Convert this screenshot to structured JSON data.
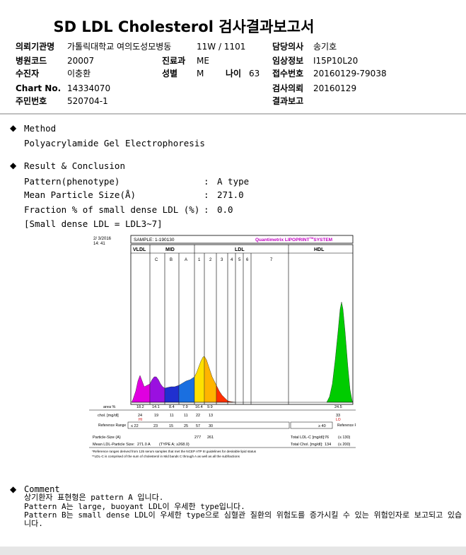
{
  "report": {
    "title": "SD LDL Cholesterol 검사결과보고서"
  },
  "info": {
    "institution_label": "의뢰기관명",
    "institution": "가톨릭대학교 여의도성모병동",
    "ward": "11W / 1101",
    "doctor_label": "담당의사",
    "doctor": "송기호",
    "hospital_code_label": "병원코드",
    "hospital_code": "20007",
    "department_label": "진료과",
    "department": "ME",
    "clinical_label": "임상정보",
    "clinical": "I15P10L20",
    "patient_label": "수진자",
    "patient": "이충환",
    "sex_label": "성별",
    "sex": "M",
    "age_label": "나이",
    "age": "63",
    "receipt_label": "접수번호",
    "receipt": "20160129-79038",
    "chart_label": "Chart No.",
    "chart_no": "14334070",
    "request_label": "검사의뢰",
    "request_date": "20160129",
    "id_label": "주민번호",
    "id_no": "520704-1",
    "result_report_label": "결과보고",
    "result_report": ""
  },
  "method": {
    "heading": "Method",
    "text": "Polyacrylamide Gel Electrophoresis"
  },
  "result": {
    "heading": "Result & Conclusion",
    "pattern_label": "Pattern(phenotype)",
    "pattern_value": "A type",
    "size_label": "Mean Particle Size(Å)",
    "size_value": "271.0",
    "fraction_label": "Fraction % of small dense LDL (%)",
    "fraction_value": "0.0",
    "note": "[Small dense LDL = LDL3~7]",
    "colon": ":"
  },
  "chart_data": {
    "type": "area",
    "header": {
      "date": "2/ 3/2016",
      "time": "14: 41",
      "sample": "SAMPLE:   1-190130",
      "brand": "Quantimetrix LIPOPRINT",
      "brand_tm": "TM",
      "brand_suffix": "SYSTEM"
    },
    "bands": [
      "VLDL",
      "MID",
      "LDL",
      "HDL"
    ],
    "sub_bands": [
      "C",
      "B",
      "A",
      "1",
      "2",
      "3",
      "4",
      "5",
      "6",
      "7"
    ],
    "band_colors": [
      "#e000e0",
      "#9a10e0",
      "#2030d0",
      "#1a6fe0",
      "#ffe000",
      "#ffb400",
      "#ff3000",
      "#00cc00"
    ],
    "table": {
      "area_label": "area %",
      "area_values": [
        "18.2",
        "14.1",
        "8.4",
        "7.9",
        "16.4",
        "9.9",
        "24.5"
      ],
      "chol_label": "chol. [mg/dl]",
      "chol_values": [
        "24",
        "19",
        "11",
        "11",
        "22",
        "13",
        "33"
      ],
      "hi_flag": "HI",
      "lo_flag": "LO",
      "ref_label": "Reference Range",
      "ref_values": [
        "≤ 22",
        "23",
        "15",
        "25",
        "57",
        "30"
      ],
      "hdl_ref": "≥ 40",
      "particle_label": "Particle-Size (A)",
      "particle_values": [
        "277",
        "261"
      ],
      "mean_label": "Mean LDL-Particle Size:",
      "mean_value": "271.0 A",
      "type_value": "(TYPE A; ≥268.0)",
      "total_ldl_label": "Total LDL-C [mg/dl]:",
      "total_ldl_value": "76",
      "total_ldl_ref": "(≤ 130)",
      "total_chol_label": "Total Chol. [mg/dl]:",
      "total_chol_value": "134",
      "total_chol_ref": "(≤ 200)"
    },
    "footnote1": "*Reference ranges derived from 125 serum samples that met the NCEP ATP III guidelines for desirable lipid status",
    "footnote2": "**LDL-C is comprised of the sum of cholesterol in Mid bands C through A as well as all the subfractions"
  },
  "comment": {
    "heading": "Comment",
    "line1": "상기환자 표현형은 pattern A 입니다.",
    "line2": "Pattern A는 large, buoyant LDL이 우세한 type입니다.",
    "line3": "Pattern B는 small dense LDL이 우세한 type으로 심혈관 질환의 위험도를 증가시킬 수 있는 위험인자로 보고되고 있습니다."
  },
  "icons": {
    "bullet": "diamond-icon"
  }
}
